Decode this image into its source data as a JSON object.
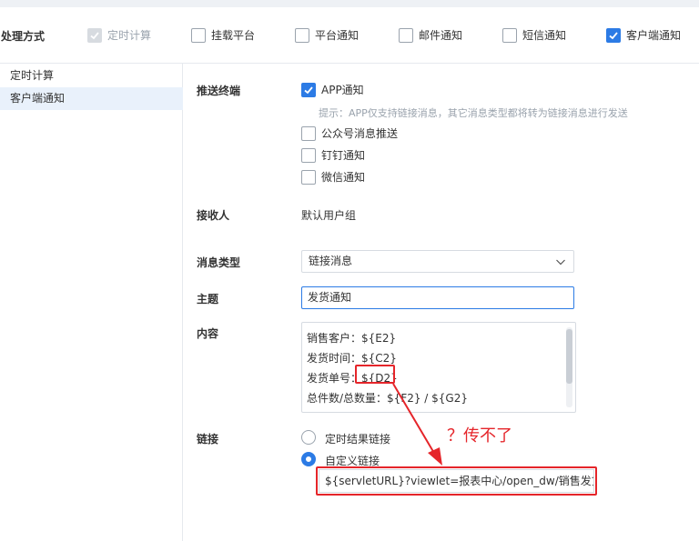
{
  "header": {
    "label": "处理方式",
    "options": [
      {
        "label": "定时计算",
        "checked": true,
        "disabled": true
      },
      {
        "label": "挂载平台",
        "checked": false,
        "disabled": false
      },
      {
        "label": "平台通知",
        "checked": false,
        "disabled": false
      },
      {
        "label": "邮件通知",
        "checked": false,
        "disabled": false
      },
      {
        "label": "短信通知",
        "checked": false,
        "disabled": false
      },
      {
        "label": "客户端通知",
        "checked": true,
        "disabled": false
      }
    ]
  },
  "sidebar": {
    "items": [
      {
        "label": "定时计算",
        "active": false
      },
      {
        "label": "客户端通知",
        "active": true
      }
    ]
  },
  "form": {
    "push_terminal": {
      "label": "推送终端",
      "options": [
        {
          "label": "APP通知",
          "checked": true
        },
        {
          "label": "公众号消息推送",
          "checked": false
        },
        {
          "label": "钉钉通知",
          "checked": false
        },
        {
          "label": "微信通知",
          "checked": false
        }
      ],
      "hint": "提示：APP仅支持链接消息，其它消息类型都将转为链接消息进行发送"
    },
    "receiver": {
      "label": "接收人",
      "value": "默认用户组"
    },
    "message_type": {
      "label": "消息类型",
      "value": "链接消息"
    },
    "subject": {
      "label": "主题",
      "value": "发货通知"
    },
    "content": {
      "label": "内容",
      "lines": [
        "销售客户：${E2}",
        "发货时间：${C2}",
        "发货单号：${D2}",
        "总件数/总数量：${F2} / ${G2}"
      ]
    },
    "link": {
      "label": "链接",
      "options": [
        {
          "label": "定时结果链接",
          "selected": false
        },
        {
          "label": "自定义链接",
          "selected": true
        }
      ],
      "value": "${servletURL}?viewlet=报表中心/open_dw/销售发货"
    }
  },
  "annotation": {
    "text": "？传不了"
  },
  "colors": {
    "accent": "#2c7be5",
    "annotation": "#e5252a"
  }
}
